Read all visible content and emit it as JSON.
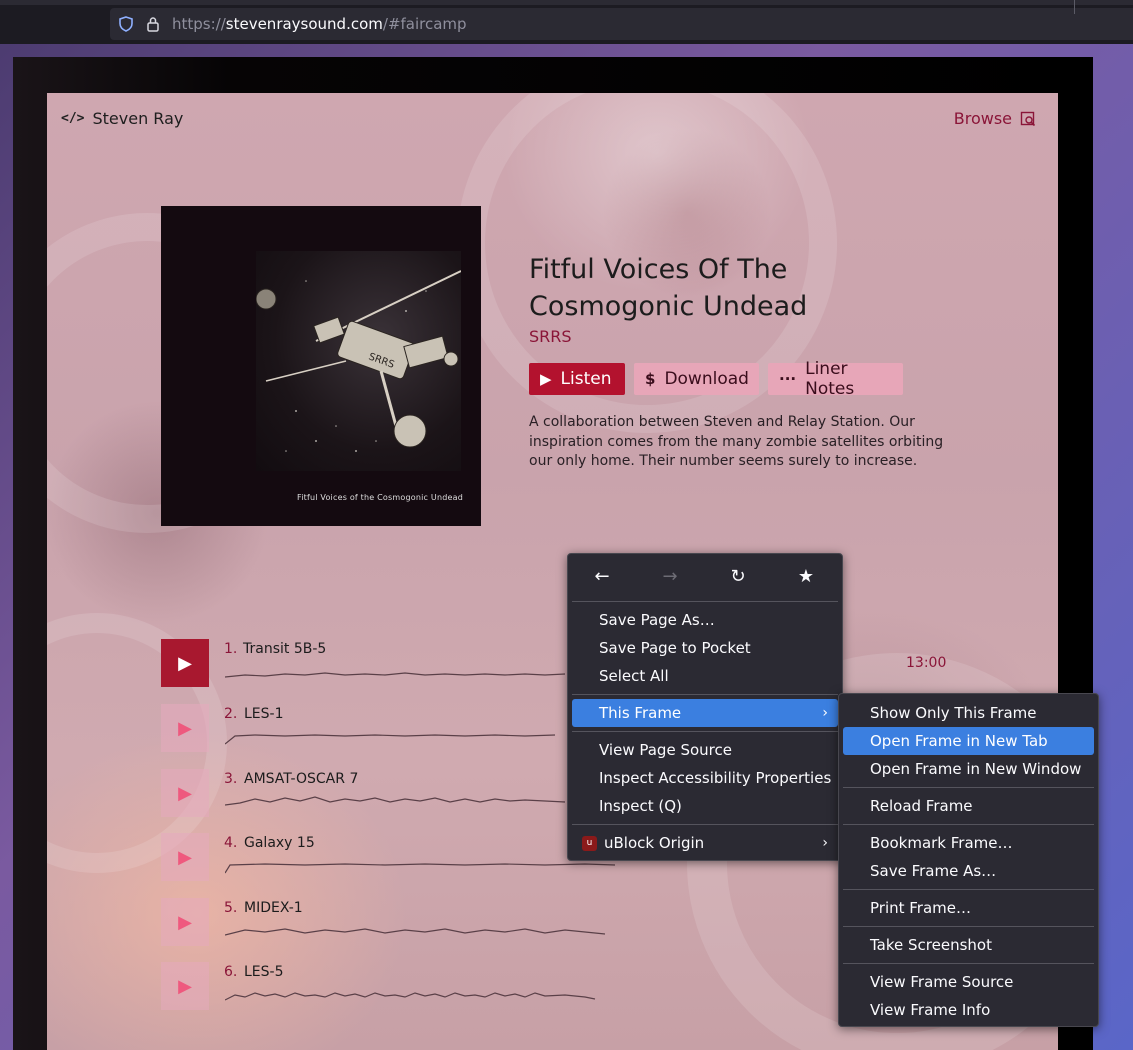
{
  "browser": {
    "url_scheme": "https://",
    "url_host": "stevenraysound.com",
    "url_path": "/#faircamp"
  },
  "site": {
    "name": "Steven Ray",
    "browse_label": "Browse"
  },
  "release": {
    "title": "Fitful Voices Of The Cosmogonic Undead",
    "artist": "SRRS",
    "cover_caption": "Fitful Voices of the Cosmogonic Undead",
    "cover_logo": "SRRS",
    "buttons": {
      "listen": "Listen",
      "download": "Download",
      "liner_notes": "Liner Notes"
    },
    "description": "A collaboration between Steven and Relay Station. Our inspiration comes from the many zombie satellites orbiting our only home. Their number seems surely to increase."
  },
  "tracks": [
    {
      "number": "1.",
      "title": "Transit 5B-5",
      "active": true
    },
    {
      "number": "2.",
      "title": "LES-1",
      "active": false
    },
    {
      "number": "3.",
      "title": "AMSAT-OSCAR 7",
      "active": false
    },
    {
      "number": "4.",
      "title": "Galaxy 15",
      "active": false
    },
    {
      "number": "5.",
      "title": "MIDEX-1",
      "active": false
    },
    {
      "number": "6.",
      "title": "LES-5",
      "active": false
    }
  ],
  "track_duration": "13:00",
  "context_menu": {
    "nav_icons": [
      "back-icon",
      "forward-icon",
      "reload-icon",
      "bookmark-star-icon"
    ],
    "items": {
      "save_page_as": "Save Page As…",
      "save_to_pocket": "Save Page to Pocket",
      "select_all": "Select All",
      "this_frame": "This Frame",
      "view_source": "View Page Source",
      "inspect_a11y": "Inspect Accessibility Properties",
      "inspect": "Inspect (Q)",
      "ublock": "uBlock Origin"
    }
  },
  "frame_submenu": {
    "show_only": "Show Only This Frame",
    "open_new_tab": "Open Frame in New Tab",
    "open_new_window": "Open Frame in New Window",
    "reload": "Reload Frame",
    "bookmark": "Bookmark Frame…",
    "save_as": "Save Frame As…",
    "print": "Print Frame…",
    "screenshot": "Take Screenshot",
    "view_source": "View Frame Source",
    "view_info": "View Frame Info"
  },
  "colors": {
    "accent": "#b3122e",
    "accent_text": "#8a1538",
    "menu_bg": "#2b2a33",
    "menu_highlight": "#3b7fe0"
  }
}
